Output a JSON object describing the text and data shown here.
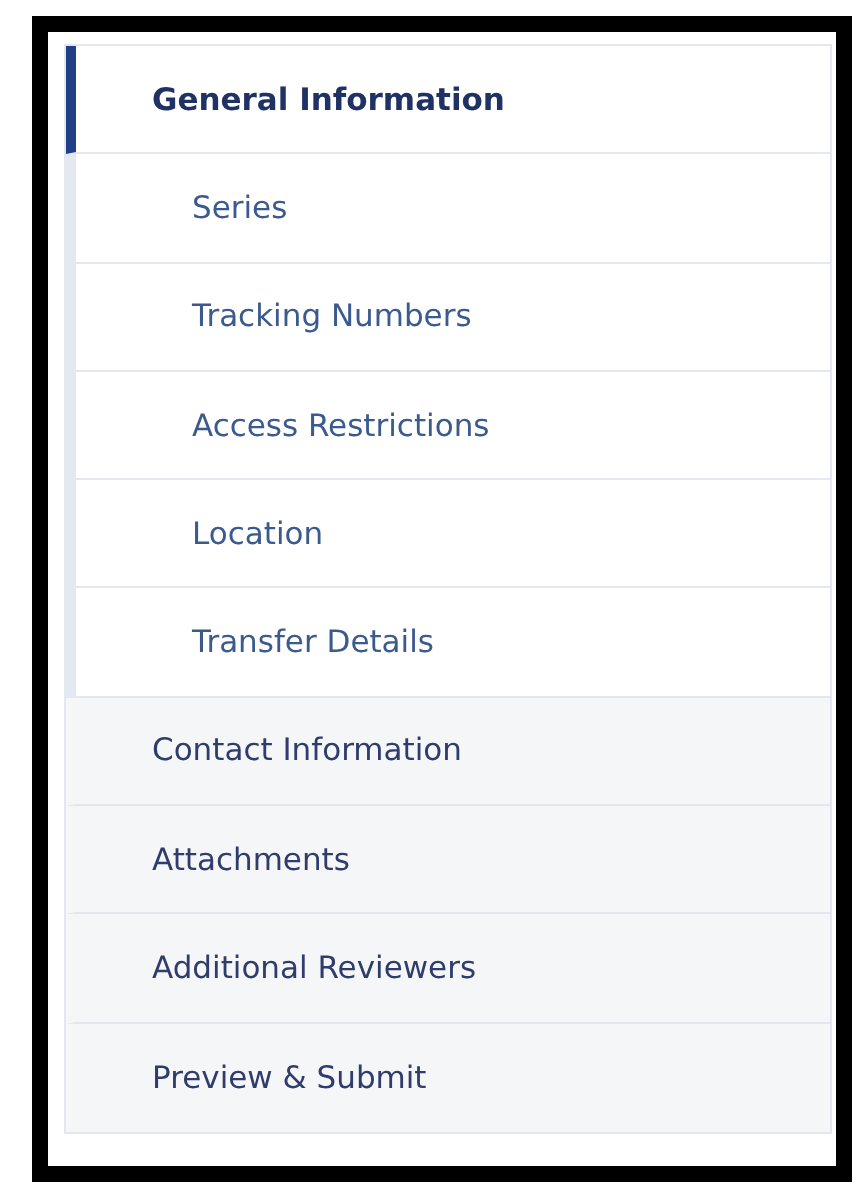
{
  "sidebar": {
    "items": [
      {
        "label": "General Information",
        "selected": true,
        "expanded": true,
        "children": [
          {
            "label": "Series",
            "selected": false
          },
          {
            "label": "Tracking Numbers",
            "selected": false
          },
          {
            "label": "Access Restrictions",
            "selected": false
          },
          {
            "label": "Location",
            "selected": false
          },
          {
            "label": "Transfer Details",
            "selected": false
          }
        ]
      },
      {
        "label": "Contact Information",
        "selected": false,
        "expanded": false
      },
      {
        "label": "Attachments",
        "selected": false,
        "expanded": false
      },
      {
        "label": "Additional Reviewers",
        "selected": false,
        "expanded": false
      },
      {
        "label": "Preview & Submit",
        "selected": false,
        "expanded": false
      }
    ]
  }
}
